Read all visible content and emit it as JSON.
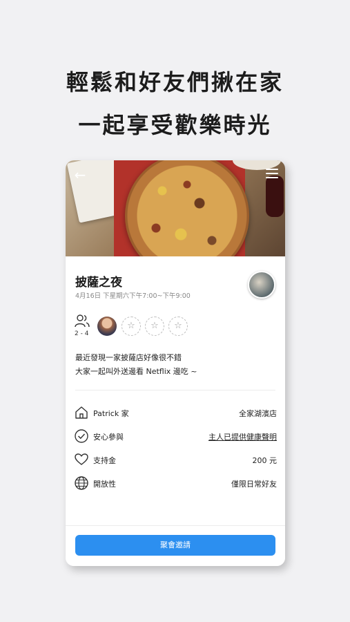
{
  "promo": {
    "line1": "輕鬆和好友們揪在家",
    "line2": "一起享受歡樂時光"
  },
  "event": {
    "title": "披薩之夜",
    "time": "4月16日 下星期六下午7:00~下午9:00",
    "people_count": "2 - 4",
    "description_line1": "最近發現一家披薩店好像很不錯",
    "description_line2": "大家一起叫外送邊看 Netflix 邊吃 ~"
  },
  "details": [
    {
      "icon": "home-icon",
      "label": "Patrick 家",
      "value": "全家湖濱店"
    },
    {
      "icon": "check-circle-icon",
      "label": "安心參與",
      "value": "主人已提供健康聲明"
    },
    {
      "icon": "heart-icon",
      "label": "支持金",
      "value": "200 元"
    },
    {
      "icon": "globe-icon",
      "label": "開放性",
      "value": "僅限日常好友"
    }
  ],
  "slots": [
    "☆",
    "☆",
    "☆"
  ],
  "actions": {
    "invite": "聚會邀請",
    "back": "←"
  },
  "colors": {
    "accent": "#2c8ff0",
    "background": "#f1f1f3"
  }
}
